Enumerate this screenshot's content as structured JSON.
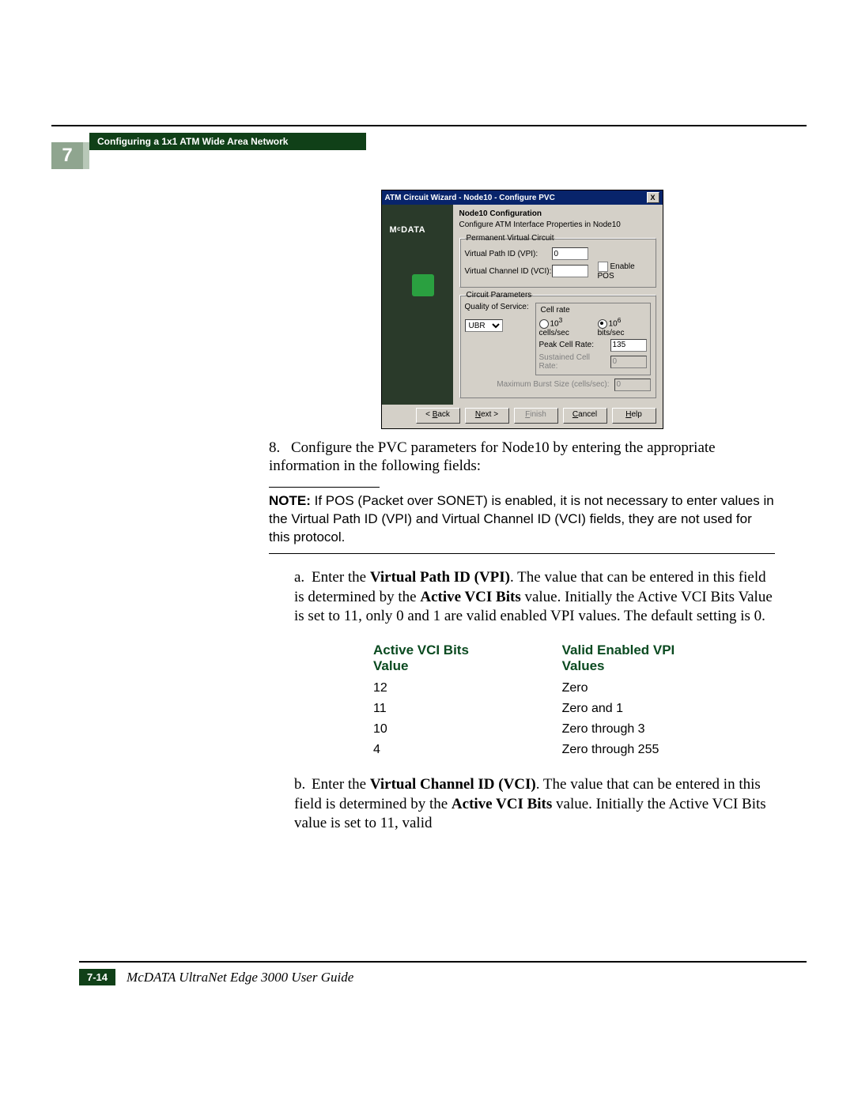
{
  "chapter": {
    "number": "7",
    "title": "Configuring a 1x1 ATM Wide Area Network"
  },
  "dialog": {
    "title": "ATM Circuit Wizard - Node10 - Configure PVC",
    "logo": "McDATA",
    "heading": "Node10 Configuration",
    "subheading": "Configure ATM Interface Properties in Node10",
    "pvc_legend": "Permanent Virtual Circuit",
    "vpi_label": "Virtual Path ID (VPI):",
    "vpi_value": "0",
    "vci_label": "Virtual Channel ID (VCI):",
    "vci_value": "",
    "enable_pos": "Enable POS",
    "circuit_legend": "Circuit Parameters",
    "qos_label": "Quality of Service:",
    "qos_value": "UBR",
    "cellrate_legend": "Cell rate",
    "opt_cells": "10  cells/sec",
    "opt_bits": "10  bits/sec",
    "cells_exp": "3",
    "bits_exp": "6",
    "peak_label": "Peak Cell Rate:",
    "peak_value": "135",
    "sustained_label": "Sustained Cell Rate:",
    "sustained_value": "0",
    "max_burst_label": "Maximum Burst Size (cells/sec):",
    "max_burst_value": "0",
    "btn_back": "< Back",
    "btn_next": "Next >",
    "btn_finish": "Finish",
    "btn_cancel": "Cancel",
    "btn_help": "Help"
  },
  "step8": {
    "num": "8.",
    "text_a": "Configure the PVC parameters for Node10 by entering the appropriate information in the following fields:"
  },
  "note": {
    "label": "NOTE:",
    "text": " If POS (Packet over SONET) is enabled, it is not necessary to enter values in the Virtual Path ID (VPI) and Virtual Channel ID (VCI) fields, they are not used for this protocol."
  },
  "sub_a": {
    "lbl": "a.",
    "pre": "Enter the ",
    "b1": "Virtual Path ID (VPI)",
    "mid1": ". The value that can be entered in this field is determined by the ",
    "b2": "Active VCI Bits",
    "mid2": " value. Initially the Active VCI Bits Value is set to 11, only 0 and 1 are valid enabled VPI values. The default setting is 0."
  },
  "table": {
    "h1": "Active VCI Bits Value",
    "h2": "Valid Enabled VPI Values",
    "rows": [
      {
        "c1": "12",
        "c2": "Zero"
      },
      {
        "c1": "11",
        "c2": "Zero and 1"
      },
      {
        "c1": "10",
        "c2": "Zero through 3"
      },
      {
        "c1": "4",
        "c2": "Zero through 255"
      }
    ]
  },
  "sub_b": {
    "lbl": "b.",
    "pre": "Enter the ",
    "b1": "Virtual Channel ID (VCI)",
    "mid1": ". The value that can be entered in this field is determined by the ",
    "b2": "Active VCI Bits",
    "mid2": " value. Initially the Active VCI Bits value is set to 11, valid"
  },
  "footer": {
    "page": "7-14",
    "book": "McDATA UltraNet Edge 3000 User Guide"
  }
}
